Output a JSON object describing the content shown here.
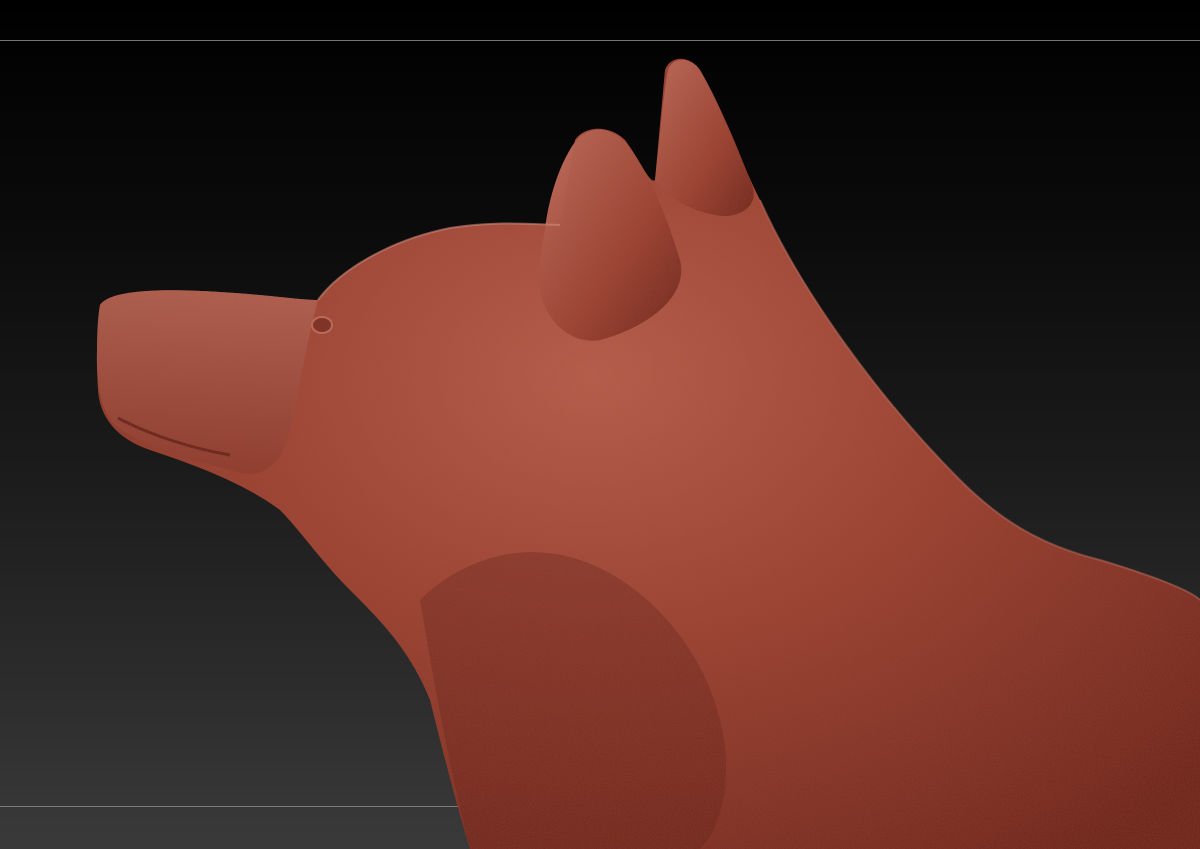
{
  "viewport": {
    "subject": "wolf-head-sculpt",
    "background_top_color": "#000000",
    "background_bottom_color": "#3a3a3a",
    "frame_line_color": "#8a8a8a"
  },
  "model": {
    "material_color": "#9a4232",
    "shadow_color": "#5a1d14",
    "highlight_color": "#c8786a"
  }
}
